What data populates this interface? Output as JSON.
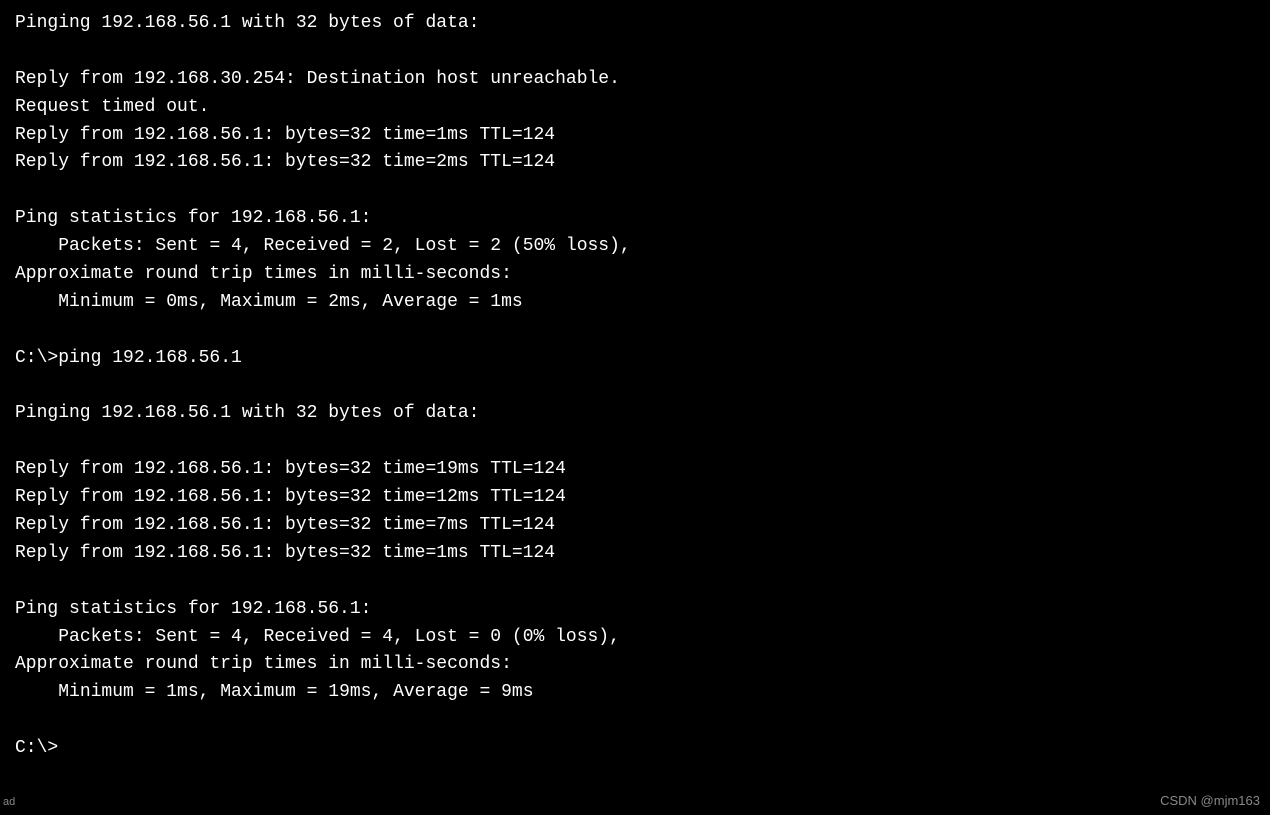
{
  "terminal": {
    "lines": [
      "Pinging 192.168.56.1 with 32 bytes of data:",
      "",
      "Reply from 192.168.30.254: Destination host unreachable.",
      "Request timed out.",
      "Reply from 192.168.56.1: bytes=32 time=1ms TTL=124",
      "Reply from 192.168.56.1: bytes=32 time=2ms TTL=124",
      "",
      "Ping statistics for 192.168.56.1:",
      "    Packets: Sent = 4, Received = 2, Lost = 2 (50% loss),",
      "Approximate round trip times in milli-seconds:",
      "    Minimum = 0ms, Maximum = 2ms, Average = 1ms",
      "",
      "C:\\>ping 192.168.56.1",
      "",
      "Pinging 192.168.56.1 with 32 bytes of data:",
      "",
      "Reply from 192.168.56.1: bytes=32 time=19ms TTL=124",
      "Reply from 192.168.56.1: bytes=32 time=12ms TTL=124",
      "Reply from 192.168.56.1: bytes=32 time=7ms TTL=124",
      "Reply from 192.168.56.1: bytes=32 time=1ms TTL=124",
      "",
      "Ping statistics for 192.168.56.1:",
      "    Packets: Sent = 4, Received = 4, Lost = 0 (0% loss),",
      "Approximate round trip times in milli-seconds:",
      "    Minimum = 1ms, Maximum = 19ms, Average = 9ms",
      "",
      "C:\\>"
    ],
    "watermark": "CSDN @mjm163",
    "small_mark": "ad"
  }
}
